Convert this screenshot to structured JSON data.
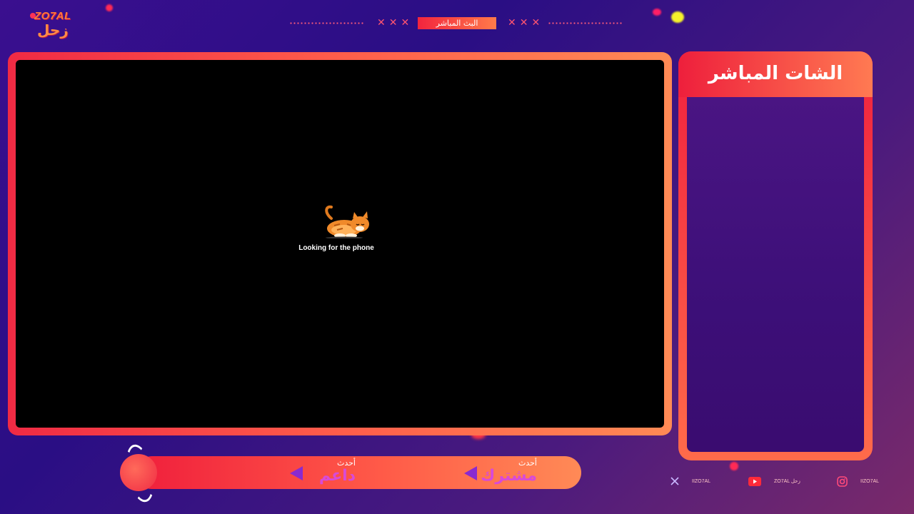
{
  "logo": {
    "latin": "ZO7AL",
    "arabic": "زحل"
  },
  "top_bar": {
    "live_label": "البث المباشر",
    "x_marks": "✕✕✕"
  },
  "video": {
    "caption": "Looking for the phone"
  },
  "chat": {
    "title": "الشات المباشر"
  },
  "bottom_bar": {
    "subscriber_small": "أحدث",
    "subscriber_big": "مشترك",
    "supporter_small": "أحدث",
    "supporter_big": "داعم"
  },
  "socials": [
    {
      "icon": "x-icon",
      "label": "IIZO7AL"
    },
    {
      "icon": "youtube-icon",
      "label": "ZO7AL زحل"
    },
    {
      "icon": "instagram-icon",
      "label": "IIZO7AL"
    }
  ],
  "colors": {
    "accent_red": "#f0203e",
    "accent_orange": "#ff8a55",
    "background": "#2a0e84",
    "name_pink": "#d84ad8"
  }
}
